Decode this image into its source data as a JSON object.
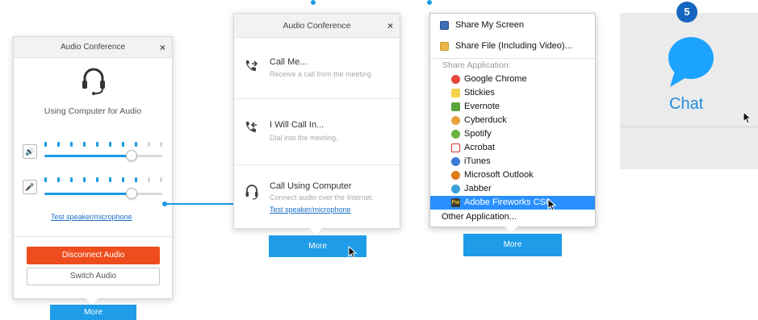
{
  "panel1": {
    "title": "Audio Conference",
    "close": "×",
    "using_text": "Using Computer for Audio",
    "speaker_icon": "🔊",
    "mic_icon": "🎤",
    "speaker_level_fraction": 0.74,
    "mic_level_fraction": 0.74,
    "test_link": "Test speaker/microphone",
    "disconnect_label": "Disconnect Audio",
    "switch_label": "Switch Audio",
    "more_label": "More"
  },
  "panel2": {
    "title": "Audio Conference",
    "close": "×",
    "items": [
      {
        "title": "Call Me...",
        "sub": "Receive a call from the meeting",
        "icon": "call-me-icon"
      },
      {
        "title": "I Will Call In...",
        "sub": "Dial into the meeting.",
        "icon": "call-in-icon"
      },
      {
        "title": "Call Using Computer",
        "sub": "Connect audio over the Internet.",
        "link": "Test speaker/microphone",
        "icon": "headset-icon"
      }
    ],
    "more_label": "More"
  },
  "panel3": {
    "share_screen": "Share My Screen",
    "share_file": "Share File (Including Video)...",
    "share_app_caption": "Share Application:",
    "apps": [
      {
        "label": "Google Chrome",
        "color": "#e8463b"
      },
      {
        "label": "Stickies",
        "color": "#f3d34a"
      },
      {
        "label": "Evernote",
        "color": "#5aa33b"
      },
      {
        "label": "Cyberduck",
        "color": "#e8a23b"
      },
      {
        "label": "Spotify",
        "color": "#6cb33f"
      },
      {
        "label": "Acrobat",
        "color": "#d9322b"
      },
      {
        "label": "iTunes",
        "color": "#3a7bd5"
      },
      {
        "label": "Microsoft Outlook",
        "color": "#e07b1a"
      },
      {
        "label": "Jabber",
        "color": "#3aa0d8"
      },
      {
        "label": "Adobe Fireworks CS6",
        "color": "#f5c518",
        "badge": "Fw"
      }
    ],
    "highlighted": "Adobe Fireworks CS6",
    "other": "Other Application...",
    "more_label": "More"
  },
  "panel4": {
    "badge": "5",
    "chat_label": "Chat",
    "accent": "#1f8de0"
  }
}
